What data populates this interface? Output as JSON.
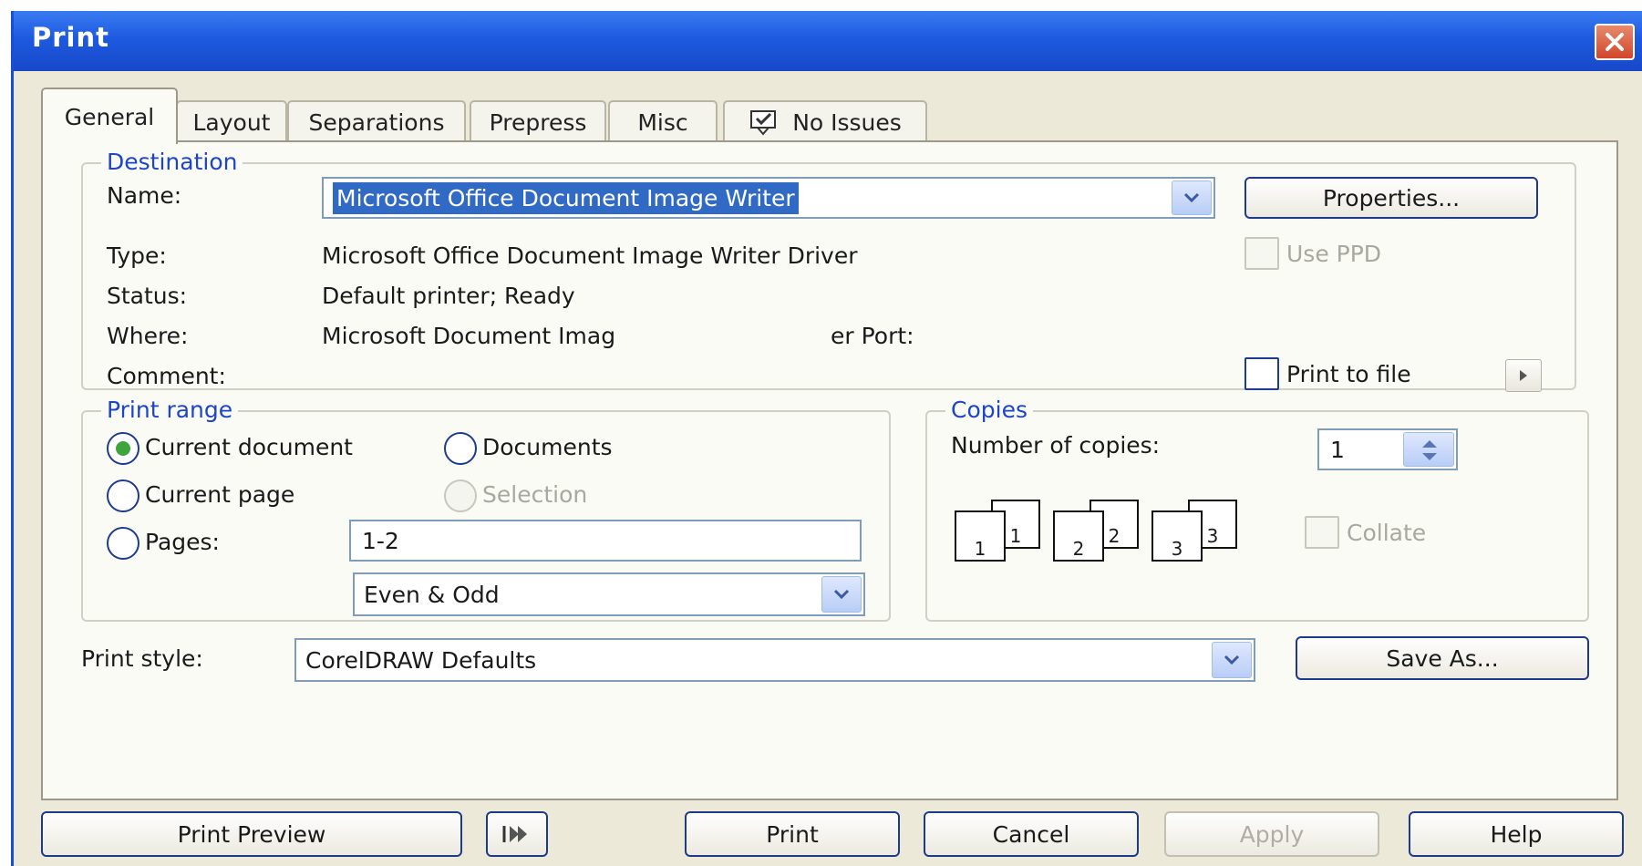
{
  "window": {
    "title": "Print"
  },
  "tabs": [
    {
      "label": "General"
    },
    {
      "label": "Layout"
    },
    {
      "label": "Separations"
    },
    {
      "label": "Prepress"
    },
    {
      "label": "Misc"
    },
    {
      "label": "No Issues"
    }
  ],
  "destination": {
    "title": "Destination",
    "name_label": "Name:",
    "name_value": "Microsoft Office Document Image Writer",
    "properties_button": "Properties...",
    "type_label": "Type:",
    "type_value": "Microsoft Office Document Image Writer Driver",
    "use_ppd_label": "Use PPD",
    "status_label": "Status:",
    "status_value": "Default printer; Ready",
    "where_label": "Where:",
    "where_value_1": "Microsoft Document Imag",
    "where_value_2": "er Port:",
    "comment_label": "Comment:",
    "print_to_file_label": "Print to file"
  },
  "print_range": {
    "title": "Print range",
    "current_document": "Current document",
    "documents": "Documents",
    "current_page": "Current page",
    "selection": "Selection",
    "pages": "Pages:",
    "pages_value": "1-2",
    "even_odd_value": "Even & Odd"
  },
  "copies": {
    "title": "Copies",
    "number_label": "Number of copies:",
    "number_value": "1",
    "collate_label": "Collate",
    "page_labels": [
      "1",
      "1",
      "2",
      "2",
      "3",
      "3"
    ]
  },
  "print_style": {
    "label": "Print style:",
    "value": "CorelDRAW Defaults",
    "save_as_button": "Save As..."
  },
  "footer": {
    "print_preview": "Print Preview",
    "print": "Print",
    "cancel": "Cancel",
    "apply": "Apply",
    "help": "Help"
  },
  "colors": {
    "titlebar": "#1d5ae0",
    "group_title": "#1c45c8",
    "selection": "#316ac5",
    "dialog_bg": "#ece9d8"
  },
  "icons": {
    "close": "close-icon",
    "no_issues": "preflight-icon",
    "dropdown": "chevron-down-icon",
    "expand": "arrow-right-icon",
    "spinner": "spinner-icon",
    "mini_preview": "mini-preview-icon"
  }
}
